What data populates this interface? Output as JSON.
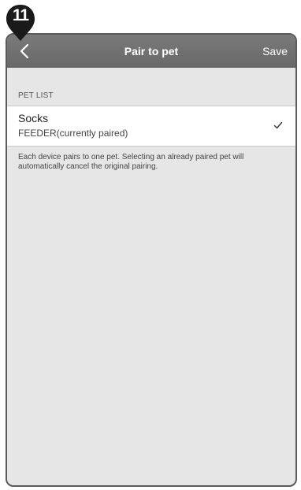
{
  "step_marker": {
    "number": "11"
  },
  "header": {
    "back_icon": "chevron-left-icon",
    "title": "Pair to pet",
    "save_label": "Save"
  },
  "pet_list": {
    "section_label": "PET LIST",
    "items": [
      {
        "name": "Socks",
        "status": "FEEDER(currently paired)",
        "selected": true,
        "check_icon": "checkmark-icon"
      }
    ]
  },
  "note": "Each device pairs to one pet. Selecting an already paired pet will automatically cancel the original pairing.",
  "colors": {
    "nav_bar": "#707070",
    "background": "#e6e6e6",
    "row_background": "#ffffff",
    "marker": "#1a1a1a"
  }
}
